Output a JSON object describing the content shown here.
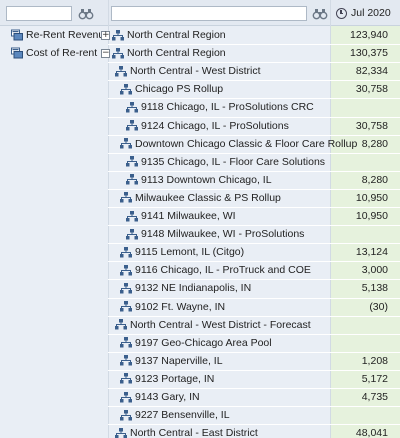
{
  "header": {
    "period_label": "Jul 2020"
  },
  "accounts": [
    {
      "label": "Re-Rent Revenue"
    },
    {
      "label": "Cost of Re-rent"
    }
  ],
  "rows": [
    {
      "label": "North Central Region",
      "value": "123,940"
    },
    {
      "label": "North Central Region",
      "value": "130,375"
    },
    {
      "label": "North Central - West District",
      "value": "82,334"
    },
    {
      "label": "Chicago PS Rollup",
      "value": "30,758"
    },
    {
      "label": "9118 Chicago, IL - ProSolutions CRC",
      "value": ""
    },
    {
      "label": "9124 Chicago, IL - ProSolutions",
      "value": "30,758"
    },
    {
      "label": "Downtown Chicago Classic & Floor Care Rollup",
      "value": "8,280"
    },
    {
      "label": "9135 Chicago, IL - Floor Care Solutions",
      "value": ""
    },
    {
      "label": "9113 Downtown Chicago, IL",
      "value": "8,280"
    },
    {
      "label": "Milwaukee Classic & PS Rollup",
      "value": "10,950"
    },
    {
      "label": "9141 Milwaukee, WI",
      "value": "10,950"
    },
    {
      "label": "9148 Milwaukee, WI - ProSolutions",
      "value": ""
    },
    {
      "label": "9115 Lemont, IL (Citgo)",
      "value": "13,124"
    },
    {
      "label": "9116 Chicago, IL - ProTruck and COE",
      "value": "3,000"
    },
    {
      "label": "9132 NE Indianapolis, IN",
      "value": "5,138"
    },
    {
      "label": "9102 Ft. Wayne, IN",
      "value": "(30)"
    },
    {
      "label": "North Central - West District - Forecast",
      "value": ""
    },
    {
      "label": "9197 Geo-Chicago Area Pool",
      "value": ""
    },
    {
      "label": "9137 Naperville, IL",
      "value": "1,208"
    },
    {
      "label": "9123 Portage, IN",
      "value": "5,172"
    },
    {
      "label": "9143 Gary, IN",
      "value": "4,735"
    },
    {
      "label": "9227 Bensenville, IL",
      "value": ""
    },
    {
      "label": "North Central - East District",
      "value": "48,041"
    }
  ]
}
